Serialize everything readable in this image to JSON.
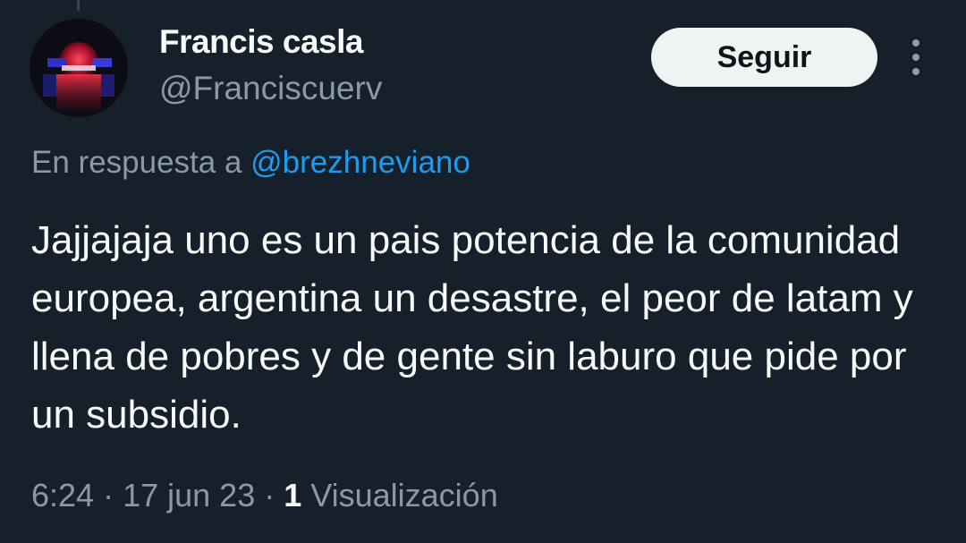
{
  "user": {
    "display_name": "Francis casla",
    "handle": "@Franciscuerv",
    "avatar_icon": "avatar-photo"
  },
  "follow_button": {
    "label": "Seguir"
  },
  "more_options": {
    "icon": "more-vertical-icon"
  },
  "reply_context": {
    "prefix": "En respuesta a ",
    "mention": "@brezhneviano"
  },
  "tweet": {
    "text": "Jajjajaja uno es un pais potencia de la comunidad europea, argentina un desastre, el peor de latam y llena de pobres y de gente sin laburo que pide por un subsidio."
  },
  "meta": {
    "time": "6:24",
    "separator": " · ",
    "date": "17 jun 23",
    "view_count": "1",
    "view_label": " Visualización"
  },
  "colors": {
    "background": "#15202b",
    "primary_text": "#f7f9f9",
    "secondary_text": "#8b98a5",
    "link": "#1d9bf0",
    "button_bg": "#eff3f4"
  }
}
